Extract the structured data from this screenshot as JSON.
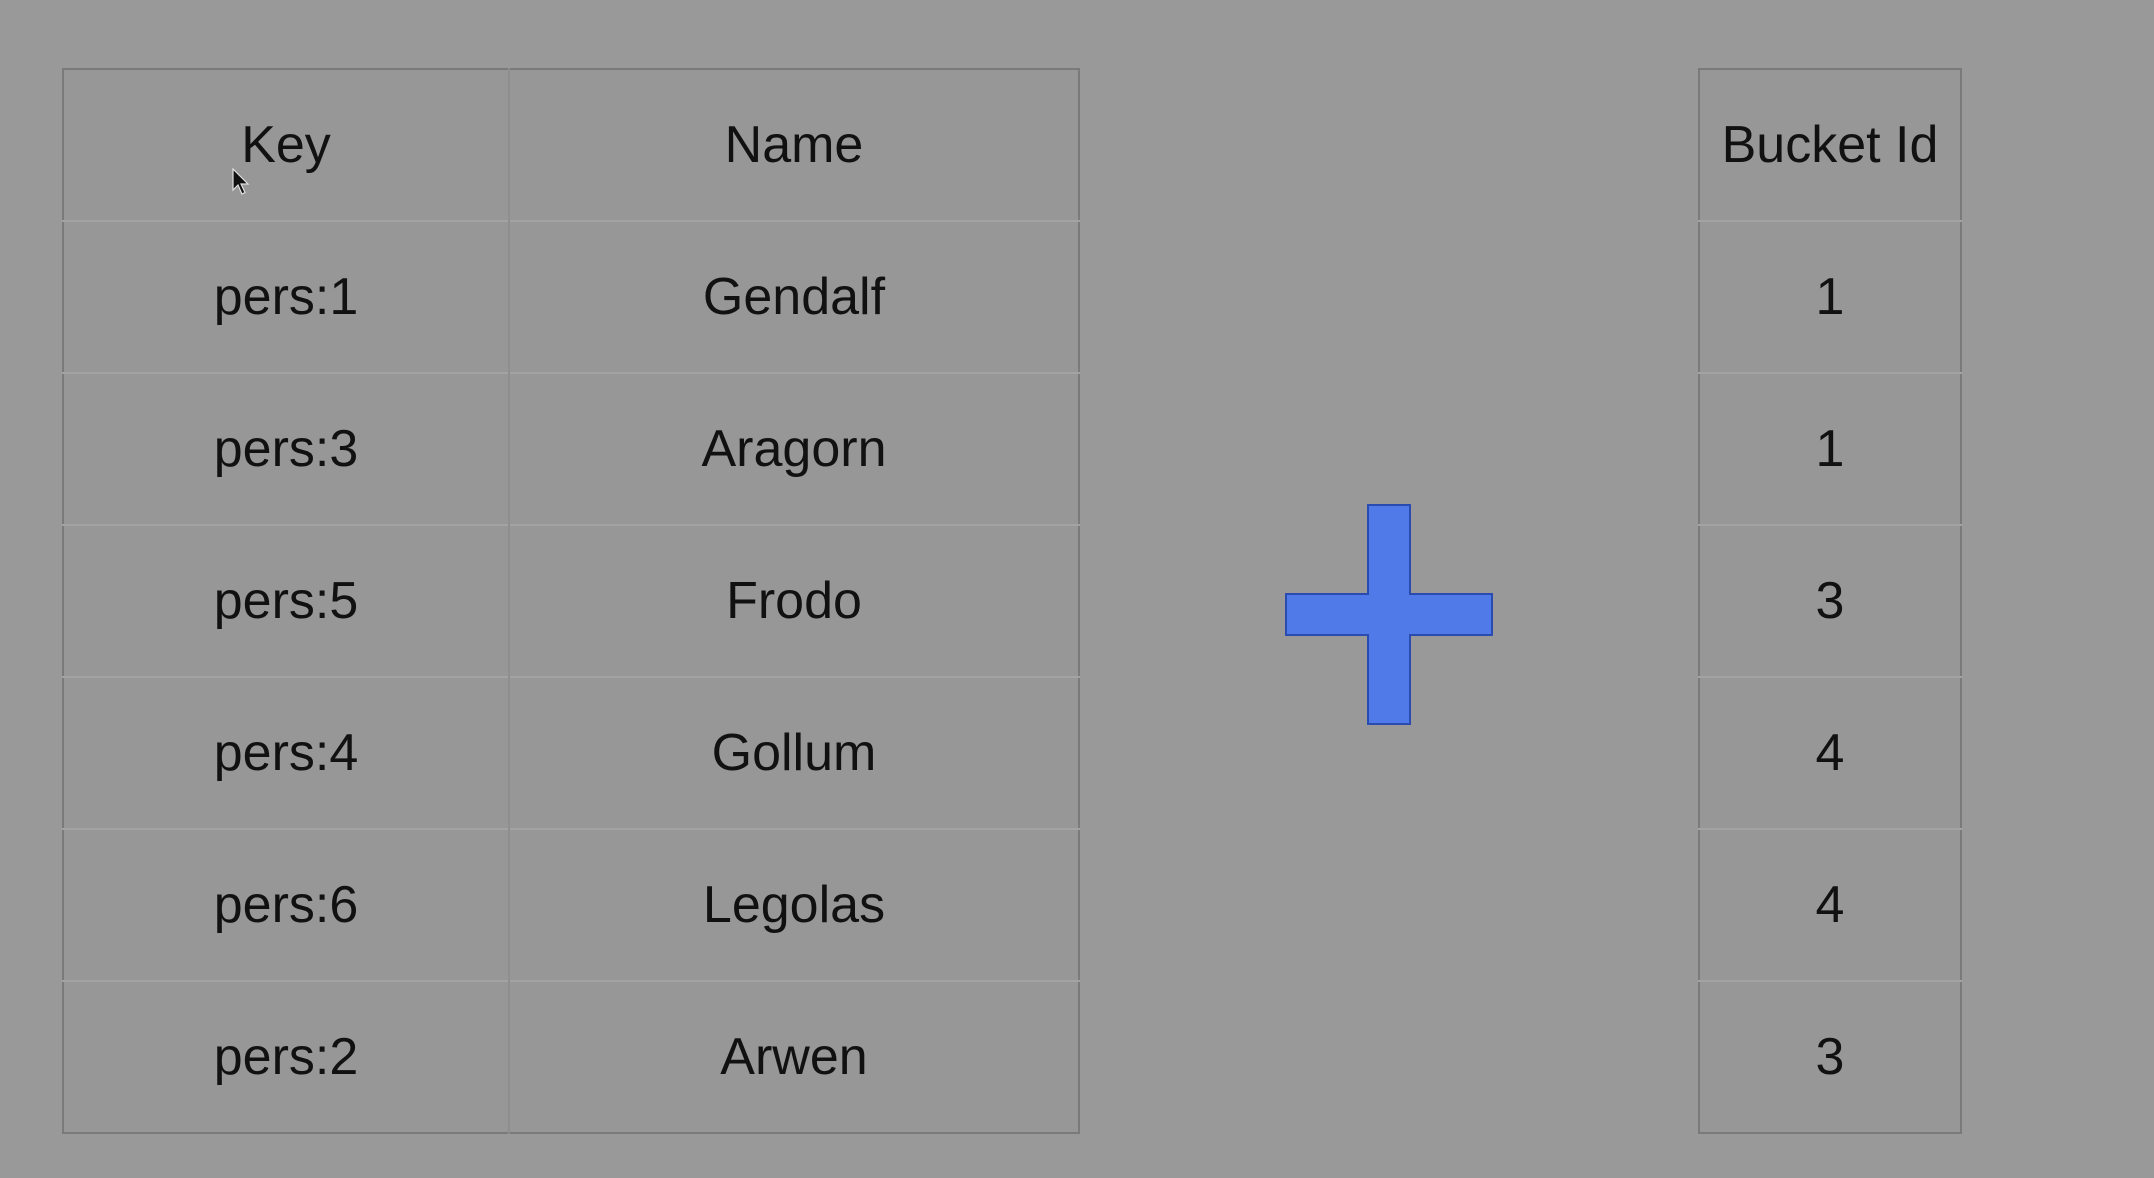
{
  "left_table": {
    "headers": [
      "Key",
      "Name"
    ],
    "rows": [
      [
        "pers:1",
        "Gendalf"
      ],
      [
        "pers:3",
        "Aragorn"
      ],
      [
        "pers:5",
        "Frodo"
      ],
      [
        "pers:4",
        "Gollum"
      ],
      [
        "pers:6",
        "Legolas"
      ],
      [
        "pers:2",
        "Arwen"
      ]
    ]
  },
  "right_table": {
    "header": "Bucket Id",
    "rows": [
      "1",
      "1",
      "3",
      "4",
      "4",
      "3"
    ]
  },
  "plus": {
    "icon": "plus-icon",
    "fill": "#4f7ae8",
    "stroke": "#2a4bb0"
  },
  "cursor": {
    "icon": "mouse-pointer-icon"
  }
}
